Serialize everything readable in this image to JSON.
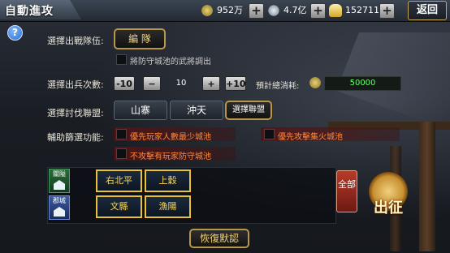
{
  "window": {
    "title": "自動進攻"
  },
  "resources": {
    "grain": "952万",
    "silver": "4.7亿",
    "gold": "152711"
  },
  "back_label": "返回",
  "help_icon": "?",
  "form": {
    "team": {
      "label": "選擇出戰隊伍:",
      "button": "編 隊",
      "checkbox_text": "將防守城池的武將調出"
    },
    "count": {
      "label": "選擇出兵次數:",
      "minus10": "-10",
      "minus": "−",
      "value": "10",
      "plus": "+",
      "plus10": "+10",
      "cost_label": "預計總消耗:",
      "cost_value": "50000"
    },
    "alliance": {
      "label": "選擇討伐聯盟:",
      "options": [
        "山寨",
        "沖天",
        "選擇聯盟"
      ],
      "selected": "選擇聯盟"
    },
    "filter": {
      "label": "輔助篩選功能:",
      "options": [
        "優先玩家人數最少城池",
        "優先攻擊集火城池",
        "不攻擊有玩家防守城池"
      ]
    }
  },
  "cities": {
    "row1_tag": "關隘",
    "row2_tag": "郡城",
    "row1": [
      "右北平",
      "上穀"
    ],
    "row2": [
      "文縣",
      "漁陽"
    ],
    "all_button": "全部"
  },
  "seal_text": "出征",
  "reset_label": "恢復默認",
  "colors": {
    "accent_gold": "#b8964a",
    "cost_green": "#6cff6c",
    "filter_orange": "#ff8a3a",
    "city_yellow": "#e8c23a"
  }
}
